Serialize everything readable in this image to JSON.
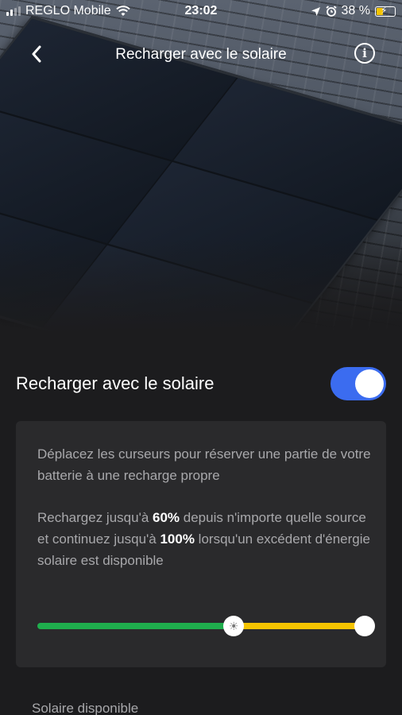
{
  "status_bar": {
    "carrier": "REGLO Mobile",
    "time": "23:02",
    "battery_percent": "38 %",
    "battery_fill": 0.38,
    "icons": [
      "signal-icon",
      "wifi-icon",
      "location-icon",
      "alarm-icon",
      "battery-charging-icon"
    ]
  },
  "navbar": {
    "title": "Recharger avec le solaire",
    "back_icon": "chevron-left-icon",
    "info_icon": "info-icon",
    "info_glyph": "i"
  },
  "toggle": {
    "label": "Recharger avec le solaire",
    "on": true,
    "color": "#3b6cf0"
  },
  "card": {
    "instruction": "Déplacez les curseurs pour réserver une partie de votre batterie à une recharge propre",
    "desc_part1": "Rechargez jusqu'à ",
    "any_source_limit": "60%",
    "desc_part2": " depuis n'importe quelle source et continuez jusqu'à ",
    "solar_limit": "100%",
    "desc_part3": " lorsqu'un excédent d'énergie solaire est disponible"
  },
  "slider": {
    "any_source_percent": 60,
    "solar_percent": 100,
    "green_color": "#1fae4d",
    "yellow_color": "#f5c400",
    "sun_icon": "sun-icon"
  },
  "section": {
    "label": "Solaire disponible"
  }
}
